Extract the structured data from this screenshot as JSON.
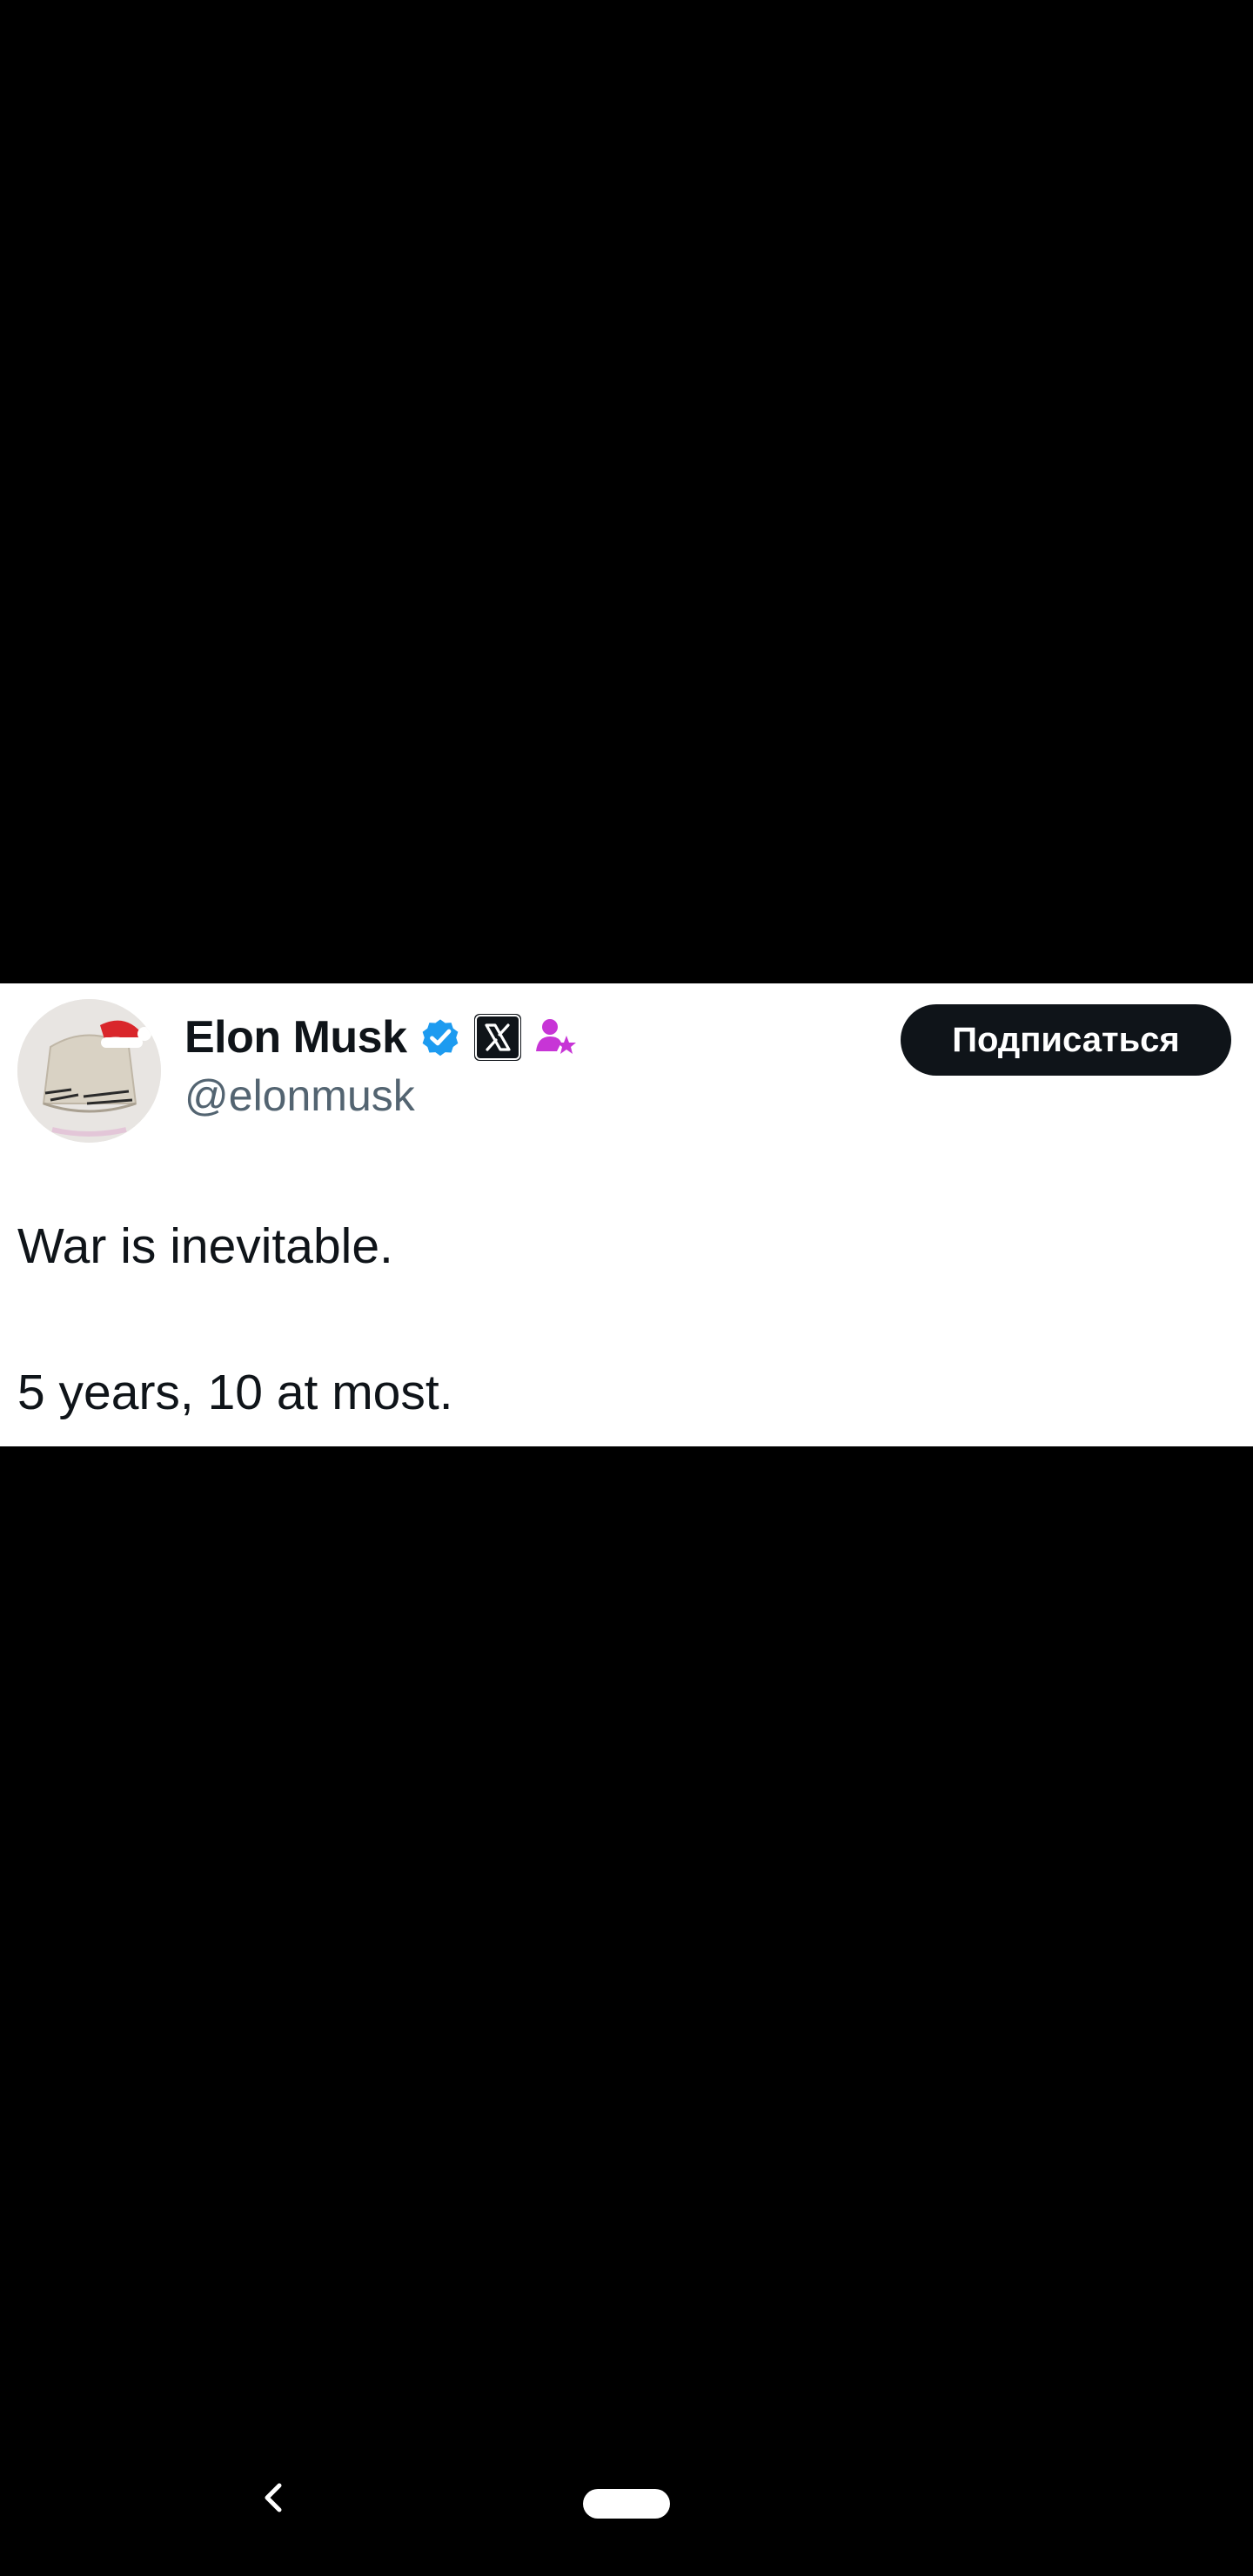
{
  "tweet": {
    "author": {
      "display_name": "Elon Musk",
      "handle": "@elonmusk",
      "badges": [
        "verified-badge-icon",
        "x-affiliate-badge-icon",
        "premium-subscriber-icon"
      ],
      "verified_color": "#1d9bf0",
      "premium_icon_color": "#c735d6"
    },
    "follow_label": "Подписаться",
    "lines": [
      "War is inevitable.",
      "5 years, 10 at most."
    ]
  },
  "nav": {
    "back_icon": "chevron-left-icon",
    "home_icon": "home-pill-icon"
  },
  "colors": {
    "background": "#000000",
    "card": "#ffffff",
    "text_primary": "#0f1419",
    "text_secondary": "#536471"
  }
}
